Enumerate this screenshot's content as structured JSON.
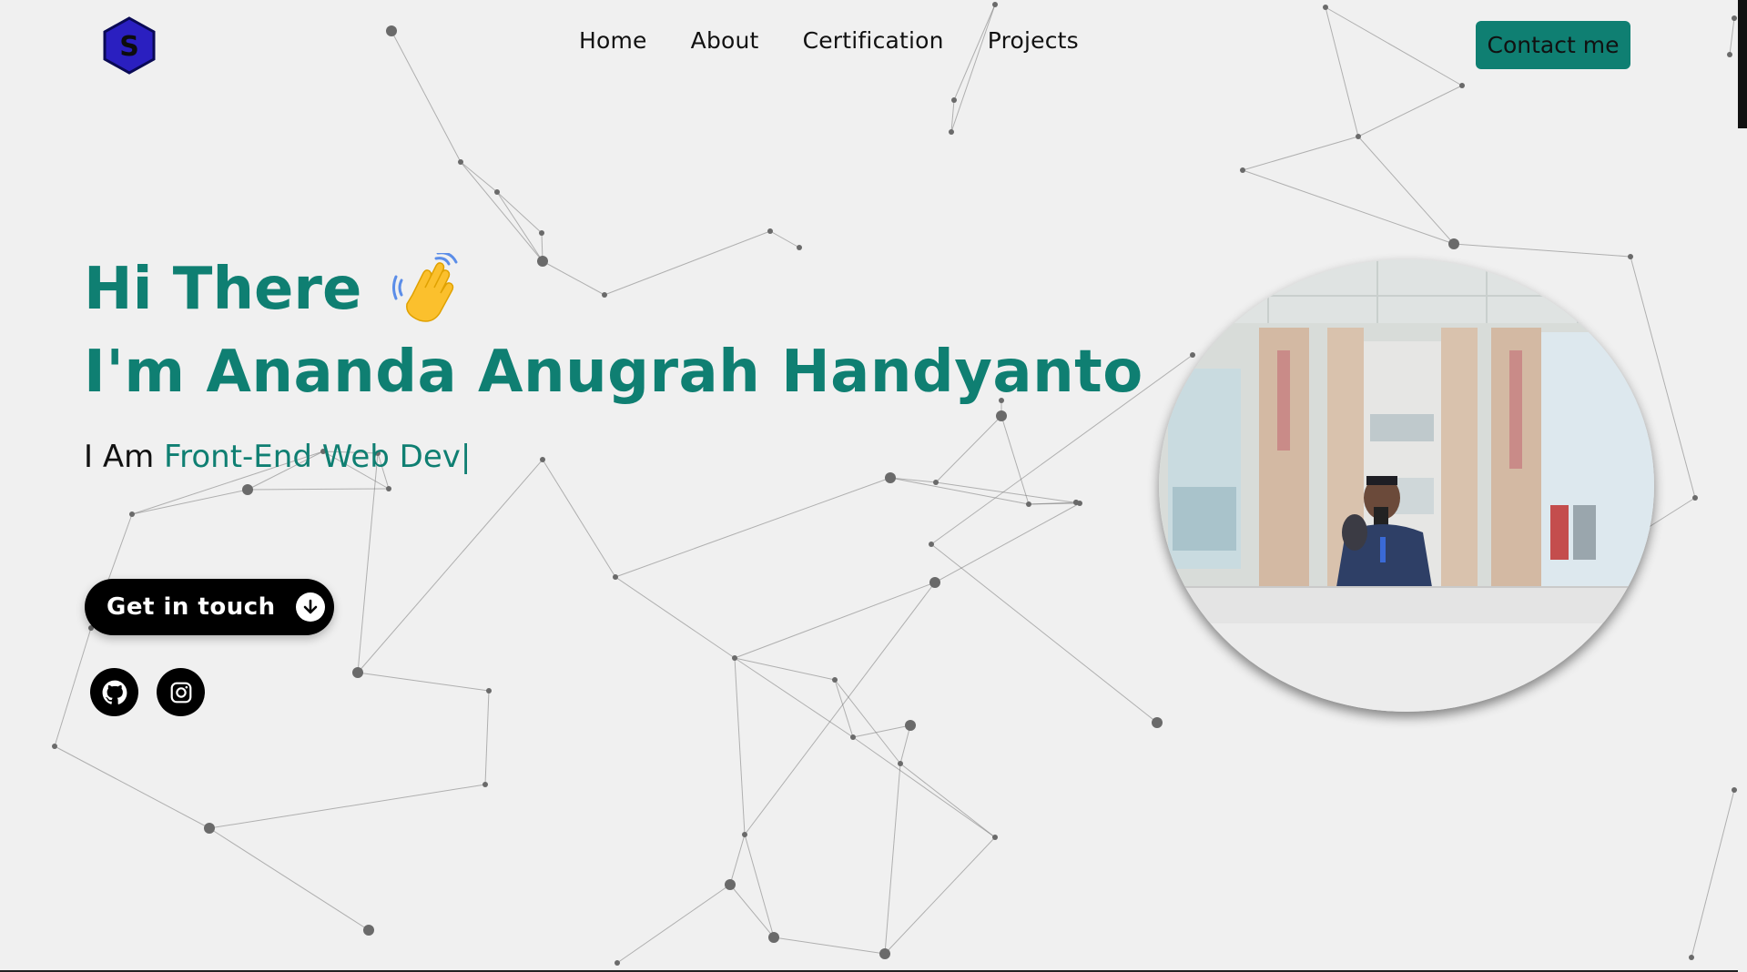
{
  "header": {
    "logo_letter": "S",
    "nav": [
      {
        "label": "Home"
      },
      {
        "label": "About"
      },
      {
        "label": "Certification"
      },
      {
        "label": "Projects"
      }
    ],
    "contact_label": "Contact me"
  },
  "hero": {
    "greeting": "Hi There",
    "name": "I'm Ananda Anugrah Handyanto",
    "role_prefix": "I Am ",
    "role_typed": "Front-End Web Dev",
    "caret": "|",
    "cta_label": "Get in touch"
  },
  "icons": {
    "wave": "waving-hand-icon",
    "cta": "arrow-down-circle-icon",
    "github": "github-icon",
    "instagram": "instagram-icon"
  },
  "colors": {
    "accent": "#0f7f72",
    "background": "#f0f0f0",
    "logo_fill": "#2a1fc0",
    "text": "#111111"
  }
}
